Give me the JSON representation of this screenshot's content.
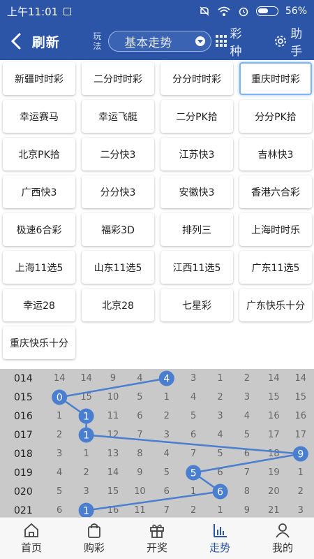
{
  "status_bar": {
    "time": "上午11:01",
    "battery": "56%"
  },
  "header": {
    "back_icon": "arrow-left-icon",
    "title": "刷新",
    "wanfa_label": "玩法",
    "select_value": "基本走势",
    "caizhong_label": "彩种",
    "zhushou_label": "助手"
  },
  "lotteries": [
    "新疆时时彩",
    "二分时时彩",
    "分分时时彩",
    "重庆时时彩",
    "幸运赛马",
    "幸运飞艇",
    "二分PK拾",
    "分分PK拾",
    "北京PK拾",
    "二分快3",
    "江苏快3",
    "吉林快3",
    "广西快3",
    "分分快3",
    "安徽快3",
    "香港六合彩",
    "极速6合彩",
    "福彩3D",
    "排列三",
    "上海时时乐",
    "上海11选5",
    "山东11选5",
    "江西11选5",
    "广东11选5",
    "幸运28",
    "北京28",
    "七星彩",
    "广东快乐十分",
    "重庆快乐十分"
  ],
  "selected_lottery": "重庆时时彩",
  "colors": {
    "header": "#2c55a8",
    "accent": "#2c55a8",
    "line": "#4a7fd0"
  },
  "trend": {
    "rows": [
      {
        "issue": "014",
        "nums": [
          "14",
          "14",
          "9",
          "4",
          "4",
          "3",
          "1",
          "2",
          "14",
          "14"
        ],
        "hit": 4
      },
      {
        "issue": "015",
        "nums": [
          "0",
          "15",
          "10",
          "5",
          "1",
          "4",
          "2",
          "3",
          "15",
          "15"
        ],
        "hit": 0
      },
      {
        "issue": "016",
        "nums": [
          "1",
          "1",
          "11",
          "6",
          "2",
          "5",
          "3",
          "4",
          "16",
          "16"
        ],
        "hit": 1
      },
      {
        "issue": "017",
        "nums": [
          "2",
          "1",
          "12",
          "7",
          "3",
          "6",
          "4",
          "5",
          "17",
          "17"
        ],
        "hit": 1
      },
      {
        "issue": "018",
        "nums": [
          "3",
          "1",
          "13",
          "8",
          "4",
          "7",
          "5",
          "6",
          "18",
          "9"
        ],
        "hit": 9
      },
      {
        "issue": "019",
        "nums": [
          "4",
          "2",
          "14",
          "9",
          "5",
          "5",
          "6",
          "7",
          "19",
          "1"
        ],
        "hit": 5
      },
      {
        "issue": "020",
        "nums": [
          "5",
          "3",
          "15",
          "10",
          "6",
          "1",
          "6",
          "8",
          "20",
          "2"
        ],
        "hit": 6
      },
      {
        "issue": "021",
        "nums": [
          "6",
          "1",
          "16",
          "11",
          "7",
          "2",
          "1",
          "9",
          "21",
          "3"
        ],
        "hit": 1
      }
    ]
  },
  "bottom_nav": [
    {
      "label": "首页",
      "icon": "home-icon"
    },
    {
      "label": "购彩",
      "icon": "bag-icon"
    },
    {
      "label": "开奖",
      "icon": "gift-icon"
    },
    {
      "label": "走势",
      "icon": "chart-icon",
      "active": true
    },
    {
      "label": "我的",
      "icon": "user-icon"
    }
  ]
}
